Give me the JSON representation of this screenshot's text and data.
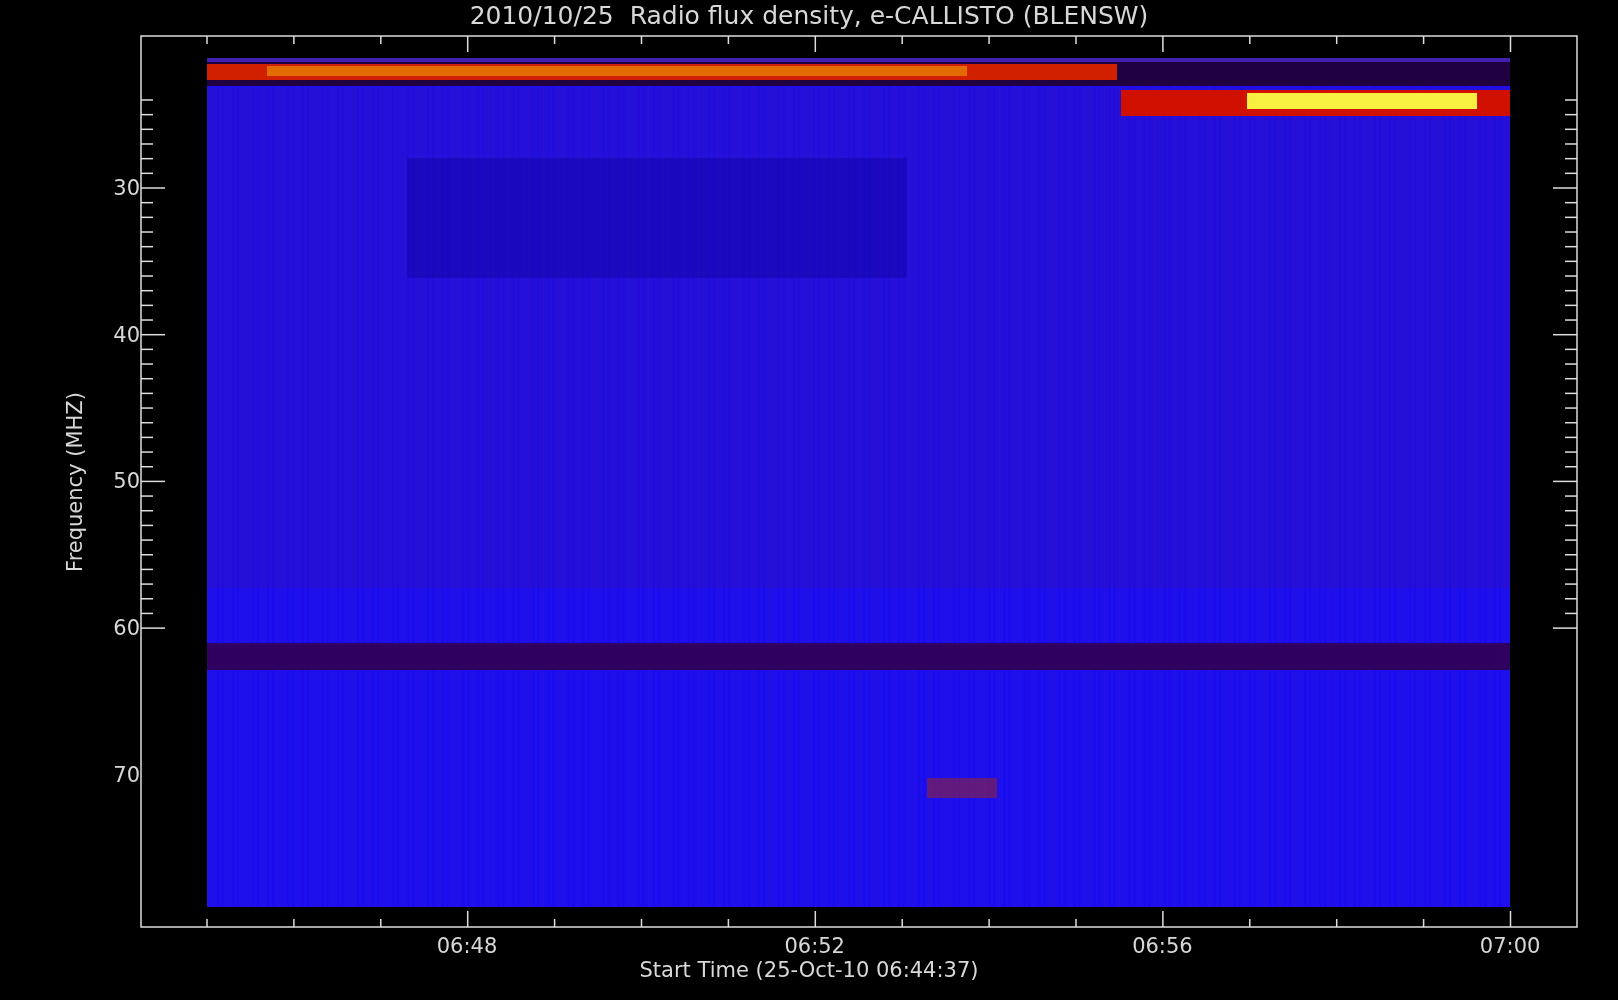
{
  "title": "2010/10/25  Radio flux density, e-CALLISTO (BLENSW)",
  "y_axis": {
    "label": "Frequency (MHZ)",
    "ticks": [
      "30",
      "40",
      "50",
      "60",
      "70"
    ]
  },
  "x_axis": {
    "label": "Start Time (25-Oct-10 06:44:37)",
    "ticks": [
      "06:48",
      "06:52",
      "06:56",
      "07:00"
    ]
  }
}
